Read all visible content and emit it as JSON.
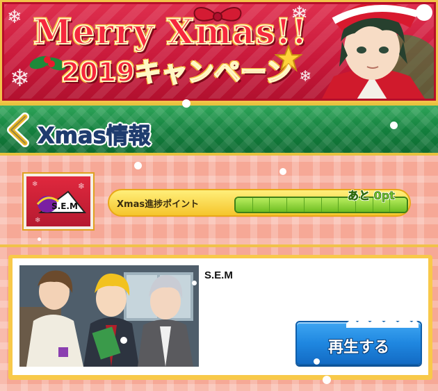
{
  "banner": {
    "title_line1": "Merry Xmas!!",
    "title_line2": "2019キャンペーン"
  },
  "header": {
    "back_icon": "chevron-left-icon",
    "title": "Xmas情報"
  },
  "unit": {
    "logo_text": "S.E.M"
  },
  "progress": {
    "label": "Xmas進捗ポイント",
    "remaining": "あと 0pt",
    "filled_segments": 10,
    "total_segments": 10
  },
  "card": {
    "title": "S.E.M",
    "play_button": "再生する"
  },
  "colors": {
    "banner_red": "#c8183a",
    "header_green": "#14813e",
    "gold": "#f0c24a",
    "play_blue": "#1f87e0"
  }
}
